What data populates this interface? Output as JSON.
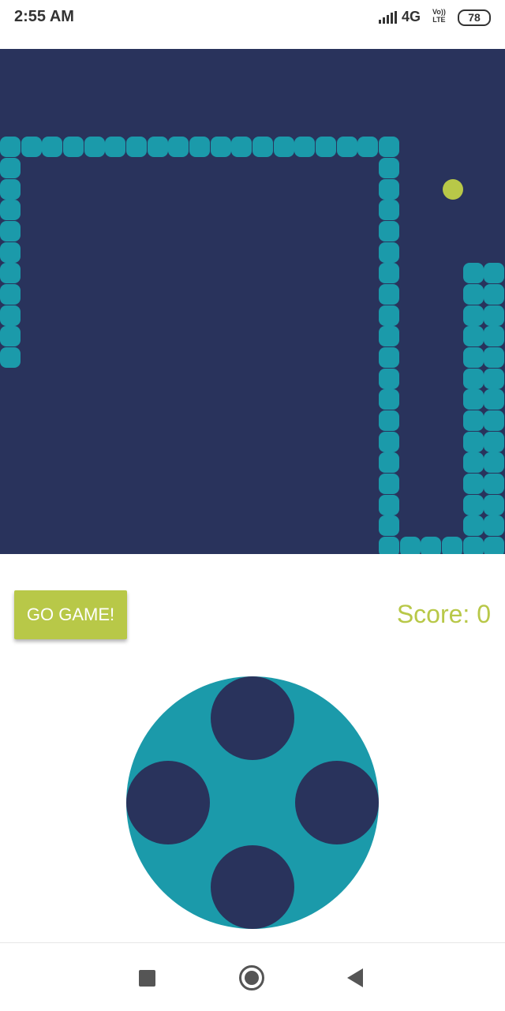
{
  "status_bar": {
    "time": "2:55 AM",
    "network": "4G",
    "volte_line1": "Vo))",
    "volte_line2": "LTE",
    "battery": "78"
  },
  "game": {
    "board_color": "#29335c",
    "snake_color": "#1b9aaa",
    "food_color": "#b8c848",
    "grid_size": 24,
    "snake_cells": [
      [
        0,
        5
      ],
      [
        1,
        5
      ],
      [
        2,
        5
      ],
      [
        3,
        5
      ],
      [
        4,
        5
      ],
      [
        5,
        5
      ],
      [
        6,
        5
      ],
      [
        7,
        5
      ],
      [
        8,
        5
      ],
      [
        9,
        5
      ],
      [
        10,
        5
      ],
      [
        11,
        5
      ],
      [
        12,
        5
      ],
      [
        13,
        5
      ],
      [
        14,
        5
      ],
      [
        15,
        5
      ],
      [
        16,
        5
      ],
      [
        17,
        5
      ],
      [
        18,
        5
      ],
      [
        0,
        6
      ],
      [
        0,
        7
      ],
      [
        0,
        8
      ],
      [
        0,
        9
      ],
      [
        0,
        10
      ],
      [
        0,
        11
      ],
      [
        0,
        12
      ],
      [
        0,
        13
      ],
      [
        0,
        14
      ],
      [
        0,
        15
      ],
      [
        18,
        6
      ],
      [
        18,
        7
      ],
      [
        18,
        8
      ],
      [
        18,
        9
      ],
      [
        18,
        10
      ],
      [
        18,
        11
      ],
      [
        18,
        12
      ],
      [
        18,
        13
      ],
      [
        18,
        14
      ],
      [
        18,
        15
      ],
      [
        18,
        16
      ],
      [
        18,
        17
      ],
      [
        18,
        18
      ],
      [
        18,
        19
      ],
      [
        18,
        20
      ],
      [
        18,
        21
      ],
      [
        18,
        22
      ],
      [
        18,
        23
      ],
      [
        18,
        24
      ],
      [
        19,
        24
      ],
      [
        20,
        24
      ],
      [
        21,
        24
      ],
      [
        22,
        24
      ],
      [
        23,
        24
      ],
      [
        22,
        11
      ],
      [
        22,
        12
      ],
      [
        22,
        13
      ],
      [
        22,
        14
      ],
      [
        22,
        15
      ],
      [
        22,
        16
      ],
      [
        22,
        17
      ],
      [
        22,
        18
      ],
      [
        22,
        19
      ],
      [
        22,
        20
      ],
      [
        22,
        21
      ],
      [
        22,
        22
      ],
      [
        22,
        23
      ],
      [
        23,
        11
      ],
      [
        23,
        12
      ],
      [
        23,
        13
      ],
      [
        23,
        14
      ],
      [
        23,
        15
      ],
      [
        23,
        16
      ],
      [
        23,
        17
      ],
      [
        23,
        18
      ],
      [
        23,
        19
      ],
      [
        23,
        20
      ],
      [
        23,
        21
      ],
      [
        23,
        22
      ],
      [
        23,
        23
      ]
    ],
    "food_cell": [
      21,
      7
    ]
  },
  "controls": {
    "go_button_label": "GO GAME!",
    "score_text": "Score: 0",
    "accent_color": "#b8c848"
  },
  "nav_bar": {
    "recent_icon": "square-icon",
    "home_icon": "circle-icon",
    "back_icon": "triangle-back-icon"
  }
}
